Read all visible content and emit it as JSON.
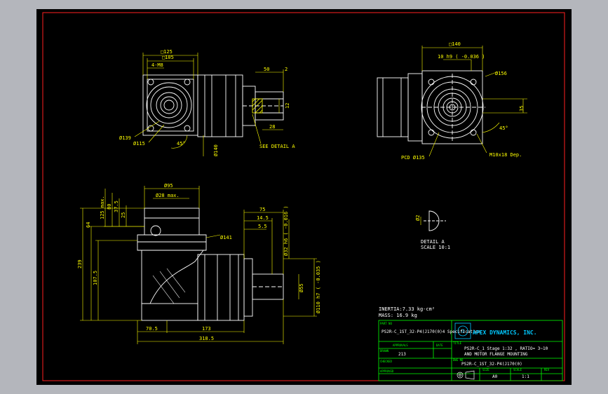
{
  "colors": {
    "background": "#b4b6bc",
    "sheet": "#000000",
    "border": "#ff2020",
    "dimension": "#ffff00",
    "outline": "#ffffff",
    "title_block": "#00ff00",
    "logo": "#00c8ff"
  },
  "front_view": {
    "dims": {
      "sq125": "□125",
      "sq105": "□105",
      "holes": "4-M8",
      "dia139": "Ø139",
      "dia115": "Ø115",
      "angle": "45°",
      "dia140": "Ø140",
      "w50": "50",
      "w2": "2",
      "h12": "12",
      "w28": "28",
      "see_detail": "SEE DETAIL A"
    }
  },
  "right_view": {
    "dims": {
      "sq140": "□140",
      "tol": "10 h9 ( -0.036 )",
      "dia156": "Ø156",
      "h35": "35",
      "angle": "45°",
      "pcd": "PCD Ø135",
      "tapped": "M10x18 Dep."
    }
  },
  "side_view": {
    "dims": {
      "d95": "Ø95",
      "d28": "Ø28 max.",
      "d141": "Ø141",
      "v125": "125 max.",
      "v80": "80",
      "v37": "37.5",
      "v25": "25",
      "v64": "64",
      "v239": "239",
      "v1075": "107.5",
      "w75": "75",
      "w145": "14.5",
      "w55": "5.5",
      "tol32": "Ø32 h6 ( -0.016 )",
      "tol110": "Ø110 h7 ( -0.035 )",
      "d55": "Ø55",
      "b705": "70.5",
      "b173": "173",
      "b3185": "318.5"
    }
  },
  "detail": {
    "dim": "Ø2",
    "label1": "DETAIL A",
    "label2": "SCALE 10:1"
  },
  "title_block": {
    "inertia": "INERTIA:7.33 kg-cm²",
    "mass": "MASS: 16.9 kg",
    "part_no_label": "PART NO",
    "part_no": "PS2R-C_1ST_32-P4(J170(0)4 Specification",
    "company": "APEX DYNAMICS, INC.",
    "type_label": "TITLE",
    "title1": "PS2R-C_1 Stage 1:32 , RATIO= 3~10",
    "title2": "AND MOTOR FLANGE MOUNTING",
    "approvals_label": "APPROVALS",
    "date_label": "DATE",
    "drawn_label": "DRAWN",
    "drawn": "213",
    "checked_label": "CHECKED",
    "approved_label": "APPROVED",
    "dwg_label": "DWG NO",
    "dwg_no": "PS2R-C_1ST_32-P4(J170(0)",
    "size_label": "SIZE",
    "size": "A0",
    "scale_label": "SCALE",
    "scale": "1:1",
    "rev_label": "REV"
  }
}
